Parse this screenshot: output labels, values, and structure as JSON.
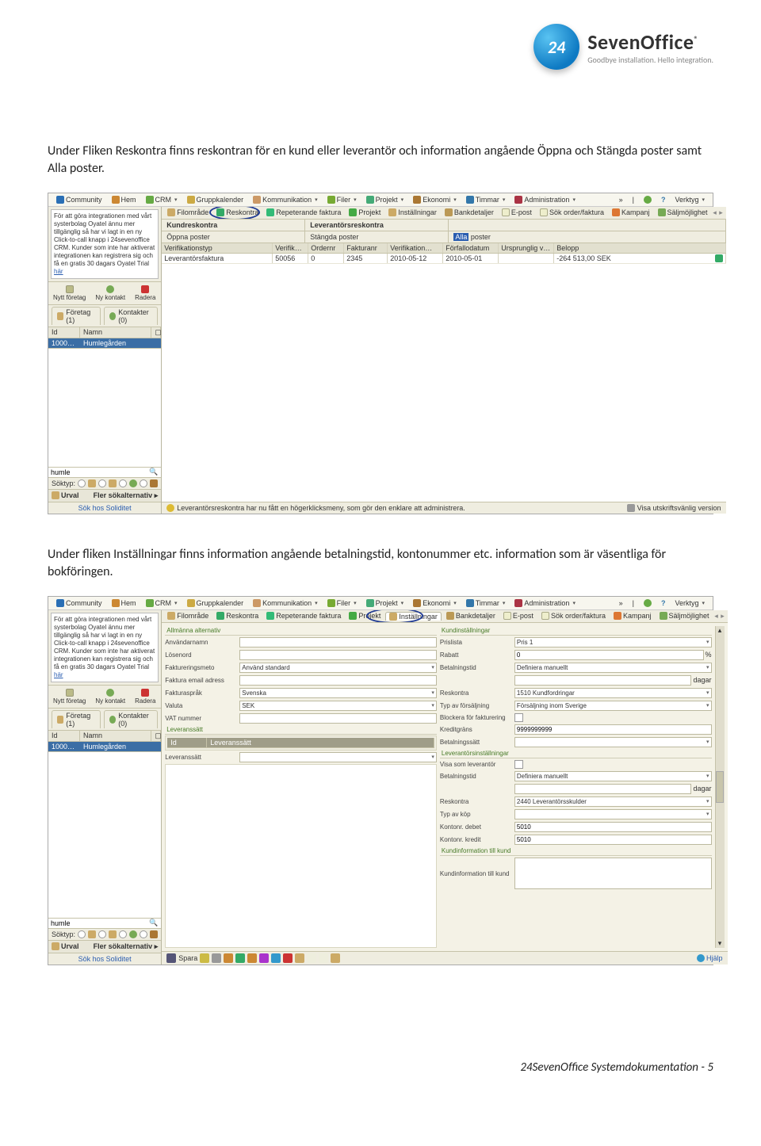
{
  "brand": {
    "badge": "24",
    "name": "SevenOffice",
    "reg": "®",
    "tagline": "Goodbye installation. Hello integration."
  },
  "para1": "Under Fliken Reskontra finns reskontran för en kund eller leverantör och information angående Öppna och Stängda poster samt Alla poster.",
  "para2": "Under fliken Inställningar finns information angående betalningstid, kontonummer etc. information som är väsentliga för bokföringen.",
  "footer": "24SevenOffice Systemdokumentation - 5",
  "menu": {
    "items": [
      "Community",
      "Hem",
      "CRM",
      "Gruppkalender",
      "Kommunikation",
      "Filer",
      "Projekt",
      "Ekonomi",
      "Timmar",
      "Administration"
    ],
    "tools": "Verktyg",
    "help": "?",
    "arrows": "»"
  },
  "leftcol": {
    "info_text": "För att göra integrationen med vårt systerbolag Oyatel ännu mer tillgänglig så har vi lagt in en ny Click-to-call knapp i 24sevenoffice CRM. Kunder som inte har aktiverat integrationen kan registrera sig och få en gratis 30 dagars Oyatel Trial",
    "info_link": "här",
    "icons": [
      {
        "label": "Nytt företag"
      },
      {
        "label": "Ny kontakt"
      },
      {
        "label": "Radera"
      }
    ],
    "tabs": [
      "Företag (1)",
      "Kontakter (0)"
    ],
    "grid": {
      "h1": "Id",
      "h2": "Namn",
      "r1a": "1000…",
      "r1b": "Humlegården"
    },
    "search": "humle",
    "soktyp": "Söktyp:",
    "urval_left": "Urval",
    "urval_right": "Fler sökalternativ",
    "sokhos": "Sök hos Soliditet"
  },
  "subtabs": [
    "Filområde",
    "Reskontra",
    "Repeterande faktura",
    "Projekt",
    "Inställningar",
    "Bankdetaljer",
    "E-post",
    "Sök order/faktura",
    "Kampanj",
    "Säljmöjlighet"
  ],
  "resk": {
    "kund_head": [
      "Kundreskontra",
      "Leverantörsreskontra"
    ],
    "kund_row": [
      "Öppna poster",
      "Stängda poster"
    ],
    "alla1": "Alla",
    "alla2": "poster",
    "cols": [
      "Verifikationstyp",
      "Verifik…",
      "Ordernr",
      "Fakturanr",
      "Verifikation…",
      "Förfallodatum",
      "Ursprunglig v…",
      "Belopp"
    ],
    "row": [
      "Leverantörsfaktura",
      "50056",
      "0",
      "2345",
      "2010-05-12",
      "2010-05-01",
      "",
      "-264 513,00 SEK"
    ],
    "status": "Leverantörsreskontra har nu fått en högerklicksmeny, som gör den enklare att administrera.",
    "print": "Visa utskriftsvänlig version"
  },
  "inst": {
    "allm": "Allmänna alternativ",
    "fields": {
      "anv": "Användarnamn",
      "los": "Lösenord",
      "fmeto_l": "Faktureringsmeto",
      "fmeto_v": "Använd standard",
      "femail": "Faktura email adress",
      "fspr_l": "Fakturaspråk",
      "fspr_v": "Svenska",
      "val_l": "Valuta",
      "val_v": "SEK",
      "vat": "VAT nummer"
    },
    "lev": {
      "title": "Leveranssätt",
      "id": "Id",
      "lev": "Leveranssätt"
    },
    "kund": {
      "title": "Kundinställningar",
      "pris_l": "Prislista",
      "pris_v": "Pris 1",
      "rab_l": "Rabatt",
      "rab_v": "0",
      "pct": "%",
      "bet_l": "Betalningstid",
      "bet_v": "Definiera manuellt",
      "dagar": "dagar",
      "resk_l": "Reskontra",
      "resk_v": "1510 Kundfordringar",
      "typf_l": "Typ av försäljning",
      "typf_v": "Försäljning inom Sverige",
      "block_l": "Blockera för fakturering",
      "kred_l": "Kreditgräns",
      "kred_v": "9999999999",
      "bsatt": "Betalningssätt"
    },
    "levi": {
      "title": "Leverantörsinställningar",
      "visa_l": "Visa som leverantör",
      "bet_l": "Betalningstid",
      "bet_v": "Definiera manuellt",
      "dagar": "dagar",
      "resk_l": "Reskontra",
      "resk_v": "2440 Leverantörsskulder",
      "typk_l": "Typ av köp",
      "kdeb_l": "Kontonr. debet",
      "kdeb_v": "5010",
      "kkre_l": "Kontonr. kredit",
      "kkre_v": "5010"
    },
    "ki": {
      "title": "Kundinformation till kund",
      "lab": "Kundinformation till kund"
    },
    "spara": "Spara",
    "hjalp": "Hjälp"
  }
}
